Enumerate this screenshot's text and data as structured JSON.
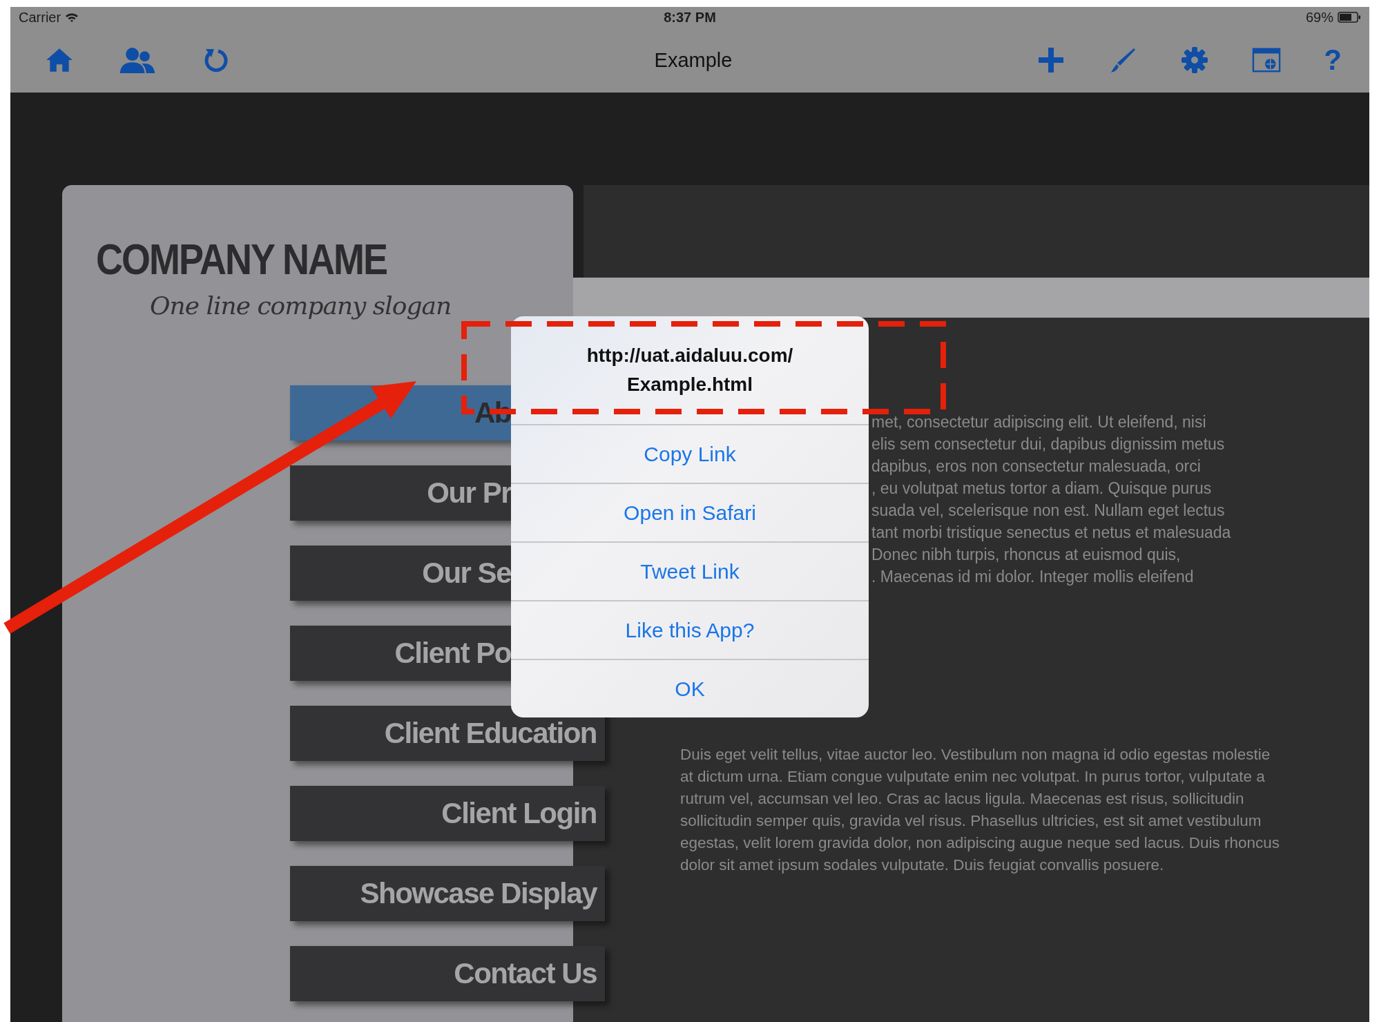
{
  "status_bar": {
    "carrier": "Carrier",
    "time": "8:37 PM",
    "battery": "69%"
  },
  "toolbar": {
    "title": "Example",
    "help": "?"
  },
  "company": {
    "name": "COMPANY NAME",
    "slogan": "One line company slogan"
  },
  "menu": [
    {
      "label": "Ab",
      "selected": true,
      "covered": true
    },
    {
      "label": "Our Pr",
      "selected": false,
      "covered": true
    },
    {
      "label": "Our Se",
      "selected": false,
      "covered": true
    },
    {
      "label": "Client Po",
      "selected": false,
      "covered": true
    },
    {
      "label": "Client Education",
      "selected": false,
      "covered": false
    },
    {
      "label": "Client Login",
      "selected": false,
      "covered": false
    },
    {
      "label": "Showcase Display",
      "selected": false,
      "covered": false
    },
    {
      "label": "Contact Us",
      "selected": false,
      "covered": false
    }
  ],
  "content": {
    "paragraph_1_lines": [
      "met, consectetur adipiscing elit. Ut eleifend, nisi",
      "elis sem consectetur dui, dapibus dignissim metus",
      "dapibus, eros non consectetur malesuada, orci",
      ", eu volutpat metus tortor a diam. Quisque purus",
      "suada vel, scelerisque non est. Nullam eget lectus",
      "tant morbi tristique senectus et netus et malesuada",
      "Donec nibh turpis, rhoncus at euismod quis,",
      ". Maecenas id mi dolor. Integer mollis eleifend"
    ],
    "paragraph_2": "Duis eget velit tellus, vitae auctor leo. Vestibulum non magna id odio egestas molestie at dictum urna. Etiam congue vulputate enim nec volutpat. In purus tortor, vulputate a rutrum vel, accumsan vel leo. Cras ac lacus ligula. Maecenas est risus, sollicitudin sollicitudin semper quis, gravida vel risus. Phasellus ultricies, est sit amet vestibulum egestas, velit lorem gravida dolor, non adipiscing augue neque sed lacus. Duis rhoncus dolor sit amet ipsum sodales vulputate. Duis feugiat convallis posuere."
  },
  "alert": {
    "title_lines": [
      "http://uat.aidaluu.com/",
      "Example.html"
    ],
    "actions": [
      "Copy Link",
      "Open in Safari",
      "Tweet Link",
      "Like this App?",
      "OK"
    ]
  }
}
